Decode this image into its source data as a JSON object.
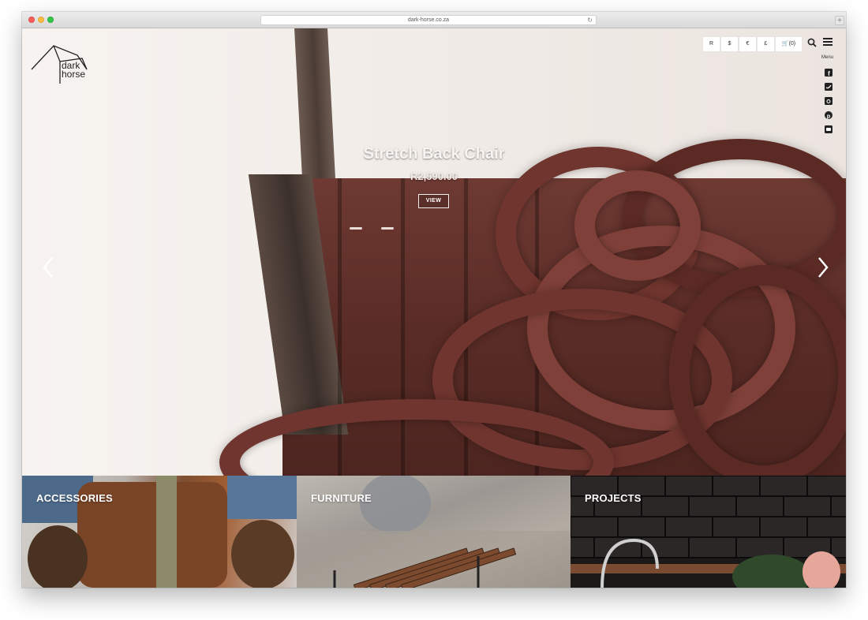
{
  "browser": {
    "url": "dark-horse.co.za"
  },
  "logo": {
    "line1": "dark",
    "line2": "horse"
  },
  "header": {
    "currencies": [
      "R",
      "$",
      "€",
      "£"
    ],
    "cart_label": "(0)",
    "menu_label": "Menu",
    "social_icons": [
      "facebook-icon",
      "twitter-icon",
      "instagram-icon",
      "pinterest-icon",
      "youtube-icon"
    ]
  },
  "hero": {
    "title": "Stretch Back Chair",
    "price": "R2,590.00",
    "button_label": "VIEW"
  },
  "categories": [
    {
      "label": "ACCESSORIES"
    },
    {
      "label": "FURNITURE"
    },
    {
      "label": "PROJECTS"
    }
  ]
}
